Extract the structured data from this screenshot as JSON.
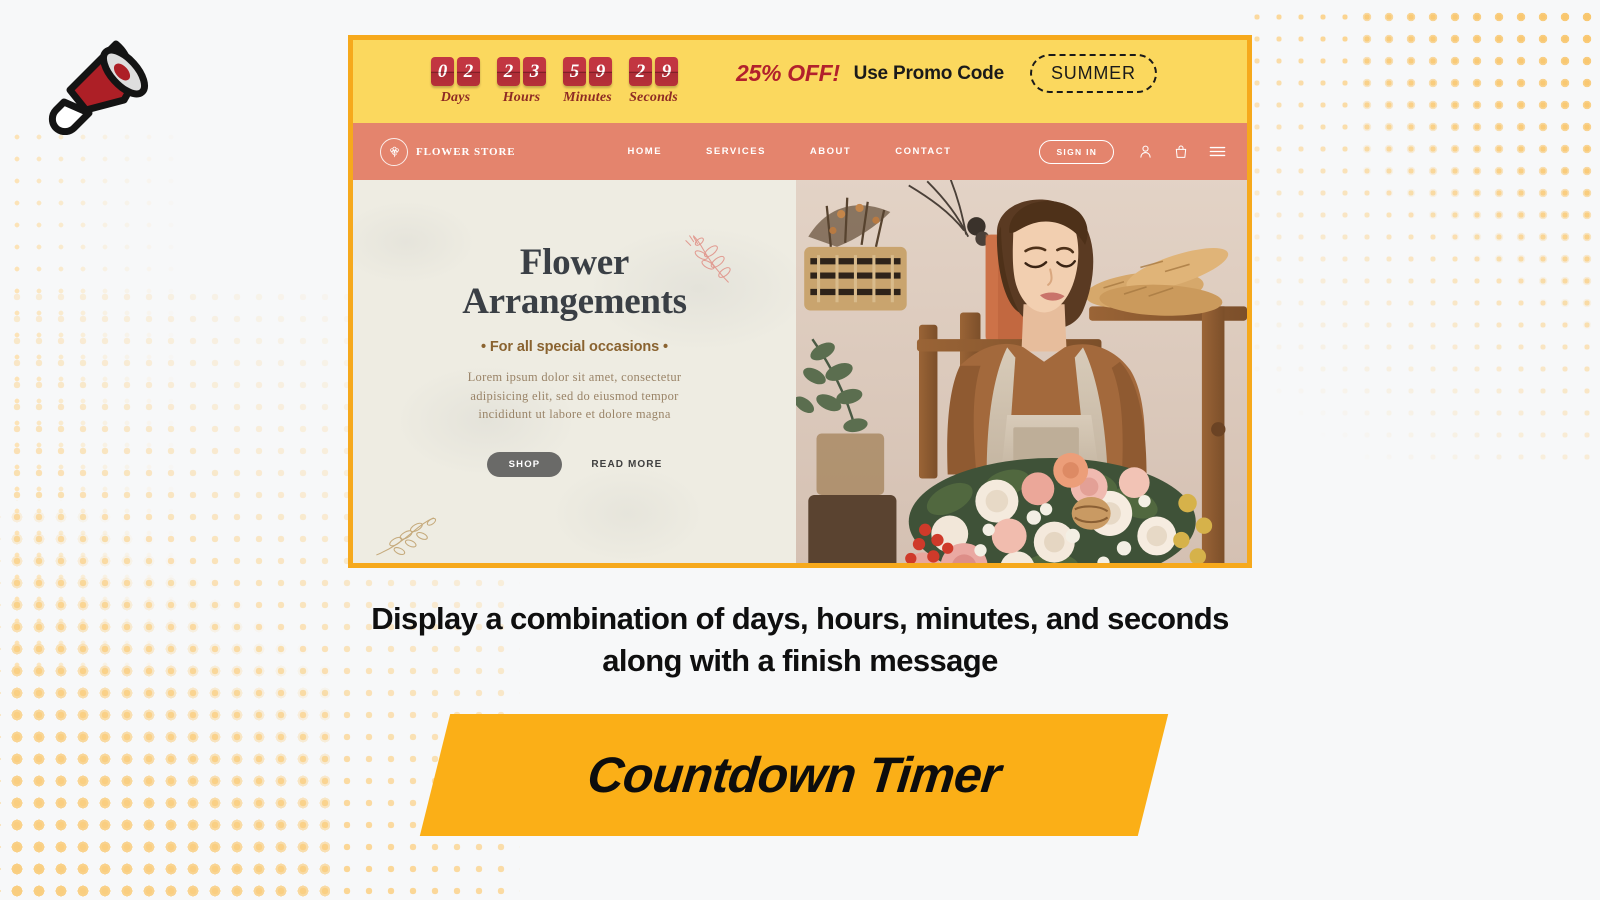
{
  "decor": {
    "megaphone_icon": "megaphone-icon",
    "dot_pattern": "halftone-dot-pattern",
    "accent_yellow": "#fbaf17",
    "accent_amber": "#fbd85e",
    "accent_coral": "#e4846d",
    "accent_red": "#b2212c",
    "frame_border": "#f6a91c"
  },
  "promo": {
    "timer": [
      {
        "label": "Days",
        "digits": [
          "0",
          "2"
        ]
      },
      {
        "label": "Hours",
        "digits": [
          "2",
          "3"
        ]
      },
      {
        "label": "Minutes",
        "digits": [
          "5",
          "9"
        ]
      },
      {
        "label": "Seconds",
        "digits": [
          "2",
          "9"
        ]
      }
    ],
    "discount": "25% OFF!",
    "use_code_label": "Use Promo Code",
    "code": "SUMMER"
  },
  "nav": {
    "brand": "FLOWER STORE",
    "brand_mark": "flower-emblem-icon",
    "links": [
      {
        "label": "HOME"
      },
      {
        "label": "SERVICES"
      },
      {
        "label": "ABOUT"
      },
      {
        "label": "CONTACT"
      }
    ],
    "signin": "SIGN IN",
    "icons": [
      "user-icon",
      "shopping-bag-icon",
      "hamburger-menu-icon"
    ]
  },
  "hero": {
    "title_line1": "Flower",
    "title_line2": "Arrangements",
    "subtitle": "• For all special occasions •",
    "body": "Lorem ipsum dolor sit amet, consectetur adipisicing elit, sed do eiusmod tempor incididunt ut labore et dolore magna",
    "shop_button": "SHOP",
    "read_more": "READ MORE",
    "image_alt": "florist-holding-bouquet-photo",
    "leaf_top_right": "leaf-branch-icon",
    "leaf_bottom_left": "leaf-branch-icon"
  },
  "caption": {
    "line1": "Display a combination of days, hours, minutes, and seconds",
    "line2": "along with a finish message"
  },
  "banner": {
    "title": "Countdown Timer"
  }
}
